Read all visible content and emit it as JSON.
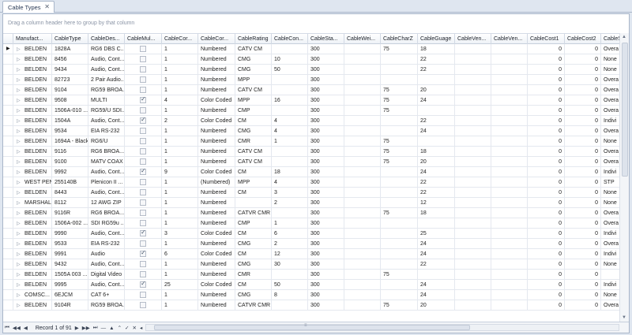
{
  "tab": {
    "title": "Cable Types",
    "close": "✕"
  },
  "group_hint": "Drag a column header here to group by that column",
  "columns": [
    "Manufact...",
    "CableType",
    "CableDes...",
    "CableMul...",
    "CableCor...",
    "CableCor...",
    "CableRating",
    "CableCon...",
    "CableSta...",
    "CableWei...",
    "CableCharZ",
    "CableGuage",
    "CableVen...",
    "CableVen...",
    "CableCost1",
    "CableCost2",
    "CableS"
  ],
  "rows": [
    {
      "mfr": "BELDEN",
      "type": "1828A",
      "desc": "RG6 DBS C...",
      "mul": false,
      "cores": "1",
      "cc": "Numbered",
      "rating": "CATV CM",
      "con": "",
      "sta": "300",
      "wei": "",
      "charz": "75",
      "gauge": "18",
      "cost1": "0",
      "cost2": "0",
      "cs": "Overa"
    },
    {
      "mfr": "BELDEN",
      "type": "8456",
      "desc": "Audio, Cont...",
      "mul": false,
      "cores": "1",
      "cc": "Numbered",
      "rating": "CMG",
      "con": "10",
      "sta": "300",
      "wei": "",
      "charz": "",
      "gauge": "22",
      "cost1": "0",
      "cost2": "0",
      "cs": "None"
    },
    {
      "mfr": "BELDEN",
      "type": "9434",
      "desc": "Audio, Cont...",
      "mul": false,
      "cores": "1",
      "cc": "Numbered",
      "rating": "CMG",
      "con": "50",
      "sta": "300",
      "wei": "",
      "charz": "",
      "gauge": "22",
      "cost1": "0",
      "cost2": "0",
      "cs": "None"
    },
    {
      "mfr": "BELDEN",
      "type": "82723",
      "desc": "2 Pair Audio...",
      "mul": false,
      "cores": "1",
      "cc": "Numbered",
      "rating": "MPP",
      "con": "",
      "sta": "300",
      "wei": "",
      "charz": "",
      "gauge": "",
      "cost1": "0",
      "cost2": "0",
      "cs": "Overa"
    },
    {
      "mfr": "BELDEN",
      "type": "9104",
      "desc": "RG59 BROA...",
      "mul": false,
      "cores": "1",
      "cc": "Numbered",
      "rating": "CATV CM",
      "con": "",
      "sta": "300",
      "wei": "",
      "charz": "75",
      "gauge": "20",
      "cost1": "0",
      "cost2": "0",
      "cs": "Overa"
    },
    {
      "mfr": "BELDEN",
      "type": "9508",
      "desc": "MULTI",
      "mul": true,
      "cores": "4",
      "cc": "Color Coded",
      "rating": "MPP",
      "con": "16",
      "sta": "300",
      "wei": "",
      "charz": "75",
      "gauge": "24",
      "cost1": "0",
      "cost2": "0",
      "cs": "Overa"
    },
    {
      "mfr": "BELDEN",
      "type": "1506A-010 ...",
      "desc": "RG59/U SDI...",
      "mul": false,
      "cores": "1",
      "cc": "Numbered",
      "rating": "CMP",
      "con": "",
      "sta": "300",
      "wei": "",
      "charz": "75",
      "gauge": "",
      "cost1": "0",
      "cost2": "0",
      "cs": "Overa"
    },
    {
      "mfr": "BELDEN",
      "type": "1504A",
      "desc": "Audio, Cont...",
      "mul": true,
      "cores": "2",
      "cc": "Color Coded",
      "rating": "CM",
      "con": "4",
      "sta": "300",
      "wei": "",
      "charz": "",
      "gauge": "22",
      "cost1": "0",
      "cost2": "0",
      "cs": "Indivi"
    },
    {
      "mfr": "BELDEN",
      "type": "9534",
      "desc": "EIA RS-232",
      "mul": false,
      "cores": "1",
      "cc": "Numbered",
      "rating": "CMG",
      "con": "4",
      "sta": "300",
      "wei": "",
      "charz": "",
      "gauge": "24",
      "cost1": "0",
      "cost2": "0",
      "cs": "Overa"
    },
    {
      "mfr": "BELDEN",
      "type": "1694A - Black",
      "desc": "RG6/U",
      "mul": false,
      "cores": "1",
      "cc": "Numbered",
      "rating": "CMR",
      "con": "1",
      "sta": "300",
      "wei": "",
      "charz": "75",
      "gauge": "",
      "cost1": "0",
      "cost2": "0",
      "cs": "None"
    },
    {
      "mfr": "BELDEN",
      "type": "9116",
      "desc": "RG6 BROA...",
      "mul": false,
      "cores": "1",
      "cc": "Numbered",
      "rating": "CATV CM",
      "con": "",
      "sta": "300",
      "wei": "",
      "charz": "75",
      "gauge": "18",
      "cost1": "0",
      "cost2": "0",
      "cs": "Overa"
    },
    {
      "mfr": "BELDEN",
      "type": "9100",
      "desc": "MATV COAX",
      "mul": false,
      "cores": "1",
      "cc": "Numbered",
      "rating": "CATV CM",
      "con": "",
      "sta": "300",
      "wei": "",
      "charz": "75",
      "gauge": "20",
      "cost1": "0",
      "cost2": "0",
      "cs": "Overa"
    },
    {
      "mfr": "BELDEN",
      "type": "9992",
      "desc": "Audio, Cont...",
      "mul": true,
      "cores": "9",
      "cc": "Color Coded",
      "rating": "CM",
      "con": "18",
      "sta": "300",
      "wei": "",
      "charz": "",
      "gauge": "24",
      "cost1": "0",
      "cost2": "0",
      "cs": "Indivi"
    },
    {
      "mfr": "WEST PEN",
      "type": "255140B",
      "desc": "Plenicon II ...",
      "mul": false,
      "cores": "1",
      "cc": "(Numbered)",
      "rating": "MPP",
      "con": "4",
      "sta": "300",
      "wei": "",
      "charz": "",
      "gauge": "22",
      "cost1": "0",
      "cost2": "0",
      "cs": "STP"
    },
    {
      "mfr": "BELDEN",
      "type": "8443",
      "desc": "Audio, Cont...",
      "mul": false,
      "cores": "1",
      "cc": "Numbered",
      "rating": "CM",
      "con": "3",
      "sta": "300",
      "wei": "",
      "charz": "",
      "gauge": "22",
      "cost1": "0",
      "cost2": "0",
      "cs": "None"
    },
    {
      "mfr": "MARSHALL",
      "type": "8112",
      "desc": "12 AWG ZIP",
      "mul": false,
      "cores": "1",
      "cc": "Numbered",
      "rating": "",
      "con": "2",
      "sta": "300",
      "wei": "",
      "charz": "",
      "gauge": "12",
      "cost1": "0",
      "cost2": "0",
      "cs": "None"
    },
    {
      "mfr": "BELDEN",
      "type": "9116R",
      "desc": "RG6 BROA...",
      "mul": false,
      "cores": "1",
      "cc": "Numbered",
      "rating": "CATVR CMR",
      "con": "",
      "sta": "300",
      "wei": "",
      "charz": "75",
      "gauge": "18",
      "cost1": "0",
      "cost2": "0",
      "cs": "Overa"
    },
    {
      "mfr": "BELDEN",
      "type": "1506A-002 ...",
      "desc": "SDI RG59u ...",
      "mul": false,
      "cores": "1",
      "cc": "Numbered",
      "rating": "CMP",
      "con": "1",
      "sta": "300",
      "wei": "",
      "charz": "",
      "gauge": "",
      "cost1": "0",
      "cost2": "0",
      "cs": "Overa"
    },
    {
      "mfr": "BELDEN",
      "type": "9990",
      "desc": "Audio, Cont...",
      "mul": true,
      "cores": "3",
      "cc": "Color Coded",
      "rating": "CM",
      "con": "6",
      "sta": "300",
      "wei": "",
      "charz": "",
      "gauge": "25",
      "cost1": "0",
      "cost2": "0",
      "cs": "Indivi"
    },
    {
      "mfr": "BELDEN",
      "type": "9533",
      "desc": "EIA RS-232",
      "mul": false,
      "cores": "1",
      "cc": "Numbered",
      "rating": "CMG",
      "con": "2",
      "sta": "300",
      "wei": "",
      "charz": "",
      "gauge": "24",
      "cost1": "0",
      "cost2": "0",
      "cs": "Overa"
    },
    {
      "mfr": "BELDEN",
      "type": "9991",
      "desc": "Audio",
      "mul": true,
      "cores": "6",
      "cc": "Color Coded",
      "rating": "CM",
      "con": "12",
      "sta": "300",
      "wei": "",
      "charz": "",
      "gauge": "24",
      "cost1": "0",
      "cost2": "0",
      "cs": "Indivi"
    },
    {
      "mfr": "BELDEN",
      "type": "9432",
      "desc": "Audio, Cont...",
      "mul": false,
      "cores": "1",
      "cc": "Numbered",
      "rating": "CMG",
      "con": "30",
      "sta": "300",
      "wei": "",
      "charz": "",
      "gauge": "22",
      "cost1": "0",
      "cost2": "0",
      "cs": "None"
    },
    {
      "mfr": "BELDEN",
      "type": "1505A 003 ...",
      "desc": "Digital Video",
      "mul": false,
      "cores": "1",
      "cc": "Numbered",
      "rating": "CMR",
      "con": "",
      "sta": "300",
      "wei": "",
      "charz": "75",
      "gauge": "",
      "cost1": "0",
      "cost2": "0",
      "cs": ""
    },
    {
      "mfr": "BELDEN",
      "type": "9995",
      "desc": "Audio, Cont...",
      "mul": true,
      "cores": "25",
      "cc": "Color Coded",
      "rating": "CM",
      "con": "50",
      "sta": "300",
      "wei": "",
      "charz": "",
      "gauge": "24",
      "cost1": "0",
      "cost2": "0",
      "cs": "Indivi"
    },
    {
      "mfr": "COMSC...",
      "type": "6EJCM",
      "desc": "CAT 6+",
      "mul": false,
      "cores": "1",
      "cc": "Numbered",
      "rating": "CMG",
      "con": "8",
      "sta": "300",
      "wei": "",
      "charz": "",
      "gauge": "24",
      "cost1": "0",
      "cost2": "0",
      "cs": "None"
    },
    {
      "mfr": "BELDEN",
      "type": "9104R",
      "desc": "RG59 BROA...",
      "mul": false,
      "cores": "1",
      "cc": "Numbered",
      "rating": "CATVR CMR",
      "con": "",
      "sta": "300",
      "wei": "",
      "charz": "75",
      "gauge": "20",
      "cost1": "0",
      "cost2": "0",
      "cs": "Overa"
    }
  ],
  "footer": {
    "record_text": "Record 1 of 91"
  }
}
